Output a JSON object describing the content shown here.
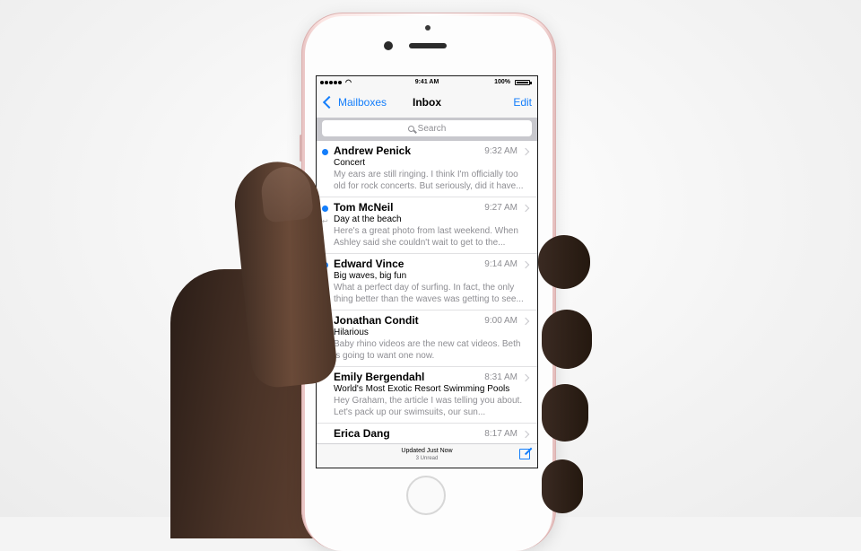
{
  "status_bar": {
    "time": "9:41 AM",
    "battery": "100%"
  },
  "nav": {
    "back_label": "Mailboxes",
    "title": "Inbox",
    "edit_label": "Edit"
  },
  "search": {
    "placeholder": "Search"
  },
  "messages": [
    {
      "sender": "Andrew Penick",
      "time": "9:32 AM",
      "subject": "Concert",
      "preview": "My ears are still ringing. I think I'm officially too old for rock concerts. But seriously, did it have...",
      "unread": true,
      "replied": false
    },
    {
      "sender": "Tom McNeil",
      "time": "9:27 AM",
      "subject": "Day at the beach",
      "preview": "Here's a great photo from last weekend. When Ashley said she couldn't wait to get to the...",
      "unread": true,
      "replied": true
    },
    {
      "sender": "Edward Vince",
      "time": "9:14 AM",
      "subject": "Big waves, big fun",
      "preview": "What a perfect day of surfing. In fact, the only thing better than the waves was getting to see...",
      "unread": true,
      "replied": true
    },
    {
      "sender": "Jonathan Condit",
      "time": "9:00 AM",
      "subject": "Hilarious",
      "preview": "Baby rhino videos are the new cat videos. Beth is going to want one now.",
      "unread": false,
      "replied": false
    },
    {
      "sender": "Emily Bergendahl",
      "time": "8:31 AM",
      "subject": "World's Most Exotic Resort Swimming Pools",
      "preview": "Hey Graham, the article I was telling you about. Let's pack up our swimsuits, our sun...",
      "unread": false,
      "replied": false
    },
    {
      "sender": "Erica Dang",
      "time": "8:17 AM",
      "subject": "",
      "preview": "",
      "unread": false,
      "replied": false
    }
  ],
  "toolbar": {
    "status": "Updated Just Now",
    "unread": "3 Unread"
  },
  "icons": {
    "back": "chevron-left-icon",
    "search": "magnifier-icon",
    "compose": "compose-icon",
    "disclosure": "chevron-right-icon",
    "unread": "unread-dot-icon",
    "replied": "reply-arrow-icon"
  },
  "colors": {
    "accent": "#147efb",
    "phone_body": "#fbe4e2"
  }
}
